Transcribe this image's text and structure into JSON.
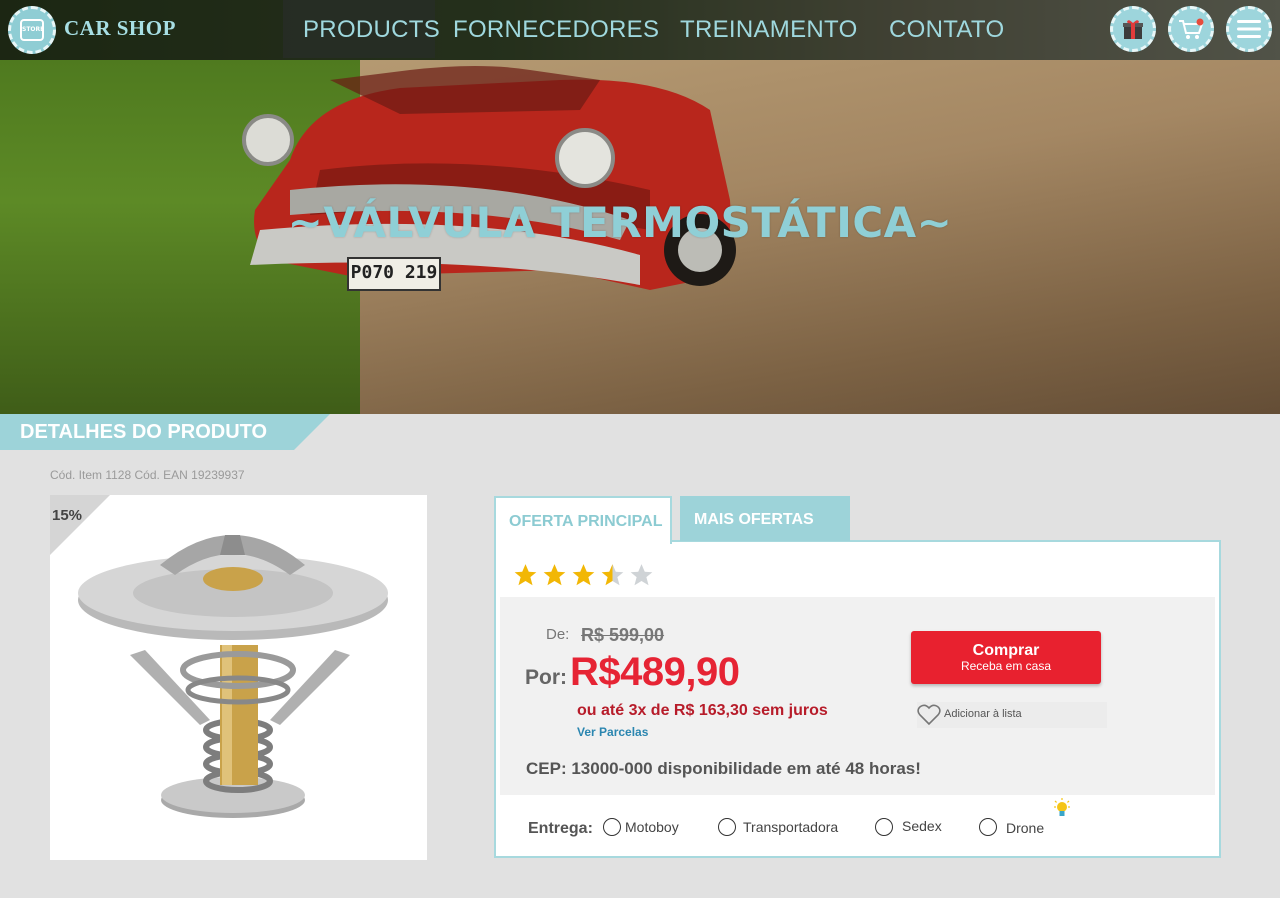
{
  "nav": {
    "logo_text": "STORE",
    "brand": "CAR SHOP",
    "items": [
      {
        "label": "PRODUCTS"
      },
      {
        "label": "FORNECEDORES"
      },
      {
        "label": "TREINAMENTO"
      },
      {
        "label": "CONTATO"
      }
    ],
    "icons": [
      "gift-icon",
      "cart-icon",
      "hamburger-menu-icon"
    ]
  },
  "hero": {
    "title": "~VÁLVULA TERMOSTÁTICA~",
    "plate": "P070 219"
  },
  "details": {
    "header": "DETALHES DO PRODUTO",
    "codes": "Cód. Item 1128 Cód. EAN 19239937",
    "discount": "15%"
  },
  "offer": {
    "tabs": [
      {
        "label": "OFERTA PRINCIPAL",
        "active": true
      },
      {
        "label": "MAIS OFERTAS",
        "active": false
      }
    ],
    "rating": 3.5,
    "rating_max": 5,
    "de_label": "De:",
    "old_price": "R$ 599,00",
    "por_label": "Por:",
    "price": "R$489,90",
    "installments": "ou até 3x de R$ 163,30 sem juros",
    "ver_parcelas": "Ver Parcelas",
    "buy_button": {
      "title": "Comprar",
      "subtitle": "Receba em casa"
    },
    "wishlist": "Adicionar à lista",
    "cep": "CEP: 13000-000 disponibilidade em até 48 horas!",
    "entrega_label": "Entrega:",
    "delivery_options": [
      {
        "label": "Motoboy"
      },
      {
        "label": "Transportadora"
      },
      {
        "label": "Sedex"
      },
      {
        "label": "Drone"
      }
    ]
  },
  "colors": {
    "accent": "#9dd3d9",
    "price_red": "#e62434",
    "buy_button": "#e8212f"
  }
}
